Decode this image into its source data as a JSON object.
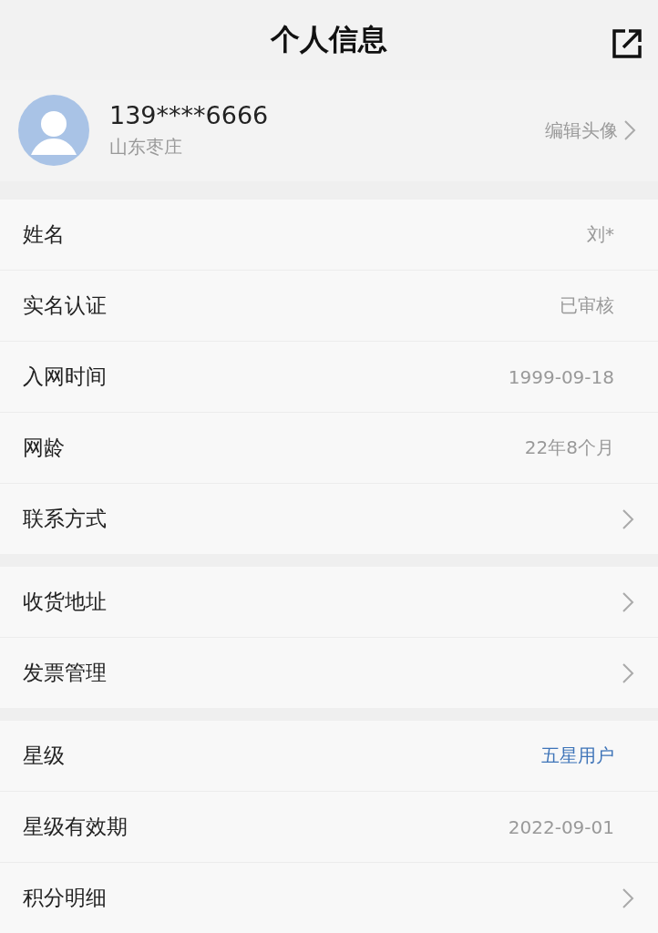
{
  "header": {
    "title": "个人信息"
  },
  "profile": {
    "phone": "139****6666",
    "location": "山东枣庄",
    "action": "编辑头像"
  },
  "sections": [
    [
      {
        "label": "姓名",
        "value": "刘*",
        "kind": "value"
      },
      {
        "label": "实名认证",
        "value": "已审核",
        "kind": "value"
      },
      {
        "label": "入网时间",
        "value": "1999-09-18",
        "kind": "value"
      },
      {
        "label": "网龄",
        "value": "22年8个月",
        "kind": "value"
      },
      {
        "label": "联系方式",
        "kind": "link"
      }
    ],
    [
      {
        "label": "收货地址",
        "kind": "link"
      },
      {
        "label": "发票管理",
        "kind": "link"
      }
    ],
    [
      {
        "label": "星级",
        "value": "五星用户",
        "kind": "highlight"
      },
      {
        "label": "星级有效期",
        "value": "2022-09-01",
        "kind": "value"
      },
      {
        "label": "积分明细",
        "kind": "link"
      }
    ]
  ]
}
